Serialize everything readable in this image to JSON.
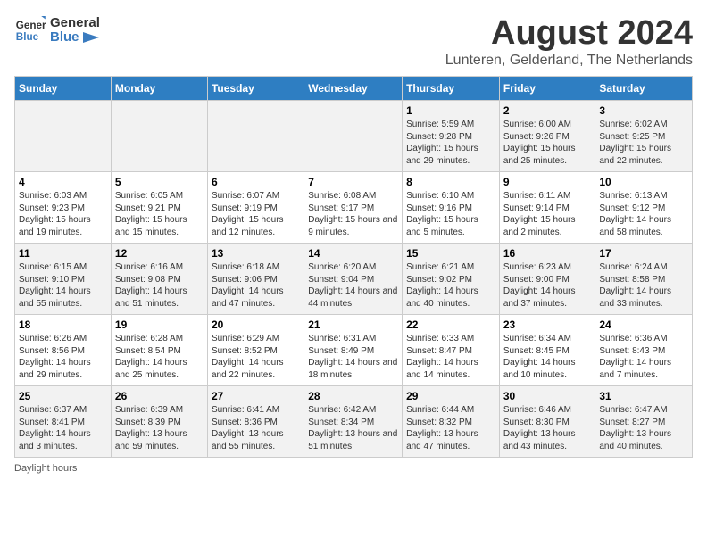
{
  "header": {
    "logo_line1": "General",
    "logo_line2": "Blue",
    "month_title": "August 2024",
    "subtitle": "Lunteren, Gelderland, The Netherlands"
  },
  "days_of_week": [
    "Sunday",
    "Monday",
    "Tuesday",
    "Wednesday",
    "Thursday",
    "Friday",
    "Saturday"
  ],
  "weeks": [
    [
      {
        "day": "",
        "info": ""
      },
      {
        "day": "",
        "info": ""
      },
      {
        "day": "",
        "info": ""
      },
      {
        "day": "",
        "info": ""
      },
      {
        "day": "1",
        "info": "Sunrise: 5:59 AM\nSunset: 9:28 PM\nDaylight: 15 hours and 29 minutes."
      },
      {
        "day": "2",
        "info": "Sunrise: 6:00 AM\nSunset: 9:26 PM\nDaylight: 15 hours and 25 minutes."
      },
      {
        "day": "3",
        "info": "Sunrise: 6:02 AM\nSunset: 9:25 PM\nDaylight: 15 hours and 22 minutes."
      }
    ],
    [
      {
        "day": "4",
        "info": "Sunrise: 6:03 AM\nSunset: 9:23 PM\nDaylight: 15 hours and 19 minutes."
      },
      {
        "day": "5",
        "info": "Sunrise: 6:05 AM\nSunset: 9:21 PM\nDaylight: 15 hours and 15 minutes."
      },
      {
        "day": "6",
        "info": "Sunrise: 6:07 AM\nSunset: 9:19 PM\nDaylight: 15 hours and 12 minutes."
      },
      {
        "day": "7",
        "info": "Sunrise: 6:08 AM\nSunset: 9:17 PM\nDaylight: 15 hours and 9 minutes."
      },
      {
        "day": "8",
        "info": "Sunrise: 6:10 AM\nSunset: 9:16 PM\nDaylight: 15 hours and 5 minutes."
      },
      {
        "day": "9",
        "info": "Sunrise: 6:11 AM\nSunset: 9:14 PM\nDaylight: 15 hours and 2 minutes."
      },
      {
        "day": "10",
        "info": "Sunrise: 6:13 AM\nSunset: 9:12 PM\nDaylight: 14 hours and 58 minutes."
      }
    ],
    [
      {
        "day": "11",
        "info": "Sunrise: 6:15 AM\nSunset: 9:10 PM\nDaylight: 14 hours and 55 minutes."
      },
      {
        "day": "12",
        "info": "Sunrise: 6:16 AM\nSunset: 9:08 PM\nDaylight: 14 hours and 51 minutes."
      },
      {
        "day": "13",
        "info": "Sunrise: 6:18 AM\nSunset: 9:06 PM\nDaylight: 14 hours and 47 minutes."
      },
      {
        "day": "14",
        "info": "Sunrise: 6:20 AM\nSunset: 9:04 PM\nDaylight: 14 hours and 44 minutes."
      },
      {
        "day": "15",
        "info": "Sunrise: 6:21 AM\nSunset: 9:02 PM\nDaylight: 14 hours and 40 minutes."
      },
      {
        "day": "16",
        "info": "Sunrise: 6:23 AM\nSunset: 9:00 PM\nDaylight: 14 hours and 37 minutes."
      },
      {
        "day": "17",
        "info": "Sunrise: 6:24 AM\nSunset: 8:58 PM\nDaylight: 14 hours and 33 minutes."
      }
    ],
    [
      {
        "day": "18",
        "info": "Sunrise: 6:26 AM\nSunset: 8:56 PM\nDaylight: 14 hours and 29 minutes."
      },
      {
        "day": "19",
        "info": "Sunrise: 6:28 AM\nSunset: 8:54 PM\nDaylight: 14 hours and 25 minutes."
      },
      {
        "day": "20",
        "info": "Sunrise: 6:29 AM\nSunset: 8:52 PM\nDaylight: 14 hours and 22 minutes."
      },
      {
        "day": "21",
        "info": "Sunrise: 6:31 AM\nSunset: 8:49 PM\nDaylight: 14 hours and 18 minutes."
      },
      {
        "day": "22",
        "info": "Sunrise: 6:33 AM\nSunset: 8:47 PM\nDaylight: 14 hours and 14 minutes."
      },
      {
        "day": "23",
        "info": "Sunrise: 6:34 AM\nSunset: 8:45 PM\nDaylight: 14 hours and 10 minutes."
      },
      {
        "day": "24",
        "info": "Sunrise: 6:36 AM\nSunset: 8:43 PM\nDaylight: 14 hours and 7 minutes."
      }
    ],
    [
      {
        "day": "25",
        "info": "Sunrise: 6:37 AM\nSunset: 8:41 PM\nDaylight: 14 hours and 3 minutes."
      },
      {
        "day": "26",
        "info": "Sunrise: 6:39 AM\nSunset: 8:39 PM\nDaylight: 13 hours and 59 minutes."
      },
      {
        "day": "27",
        "info": "Sunrise: 6:41 AM\nSunset: 8:36 PM\nDaylight: 13 hours and 55 minutes."
      },
      {
        "day": "28",
        "info": "Sunrise: 6:42 AM\nSunset: 8:34 PM\nDaylight: 13 hours and 51 minutes."
      },
      {
        "day": "29",
        "info": "Sunrise: 6:44 AM\nSunset: 8:32 PM\nDaylight: 13 hours and 47 minutes."
      },
      {
        "day": "30",
        "info": "Sunrise: 6:46 AM\nSunset: 8:30 PM\nDaylight: 13 hours and 43 minutes."
      },
      {
        "day": "31",
        "info": "Sunrise: 6:47 AM\nSunset: 8:27 PM\nDaylight: 13 hours and 40 minutes."
      }
    ]
  ],
  "footer": {
    "daylight_label": "Daylight hours"
  }
}
